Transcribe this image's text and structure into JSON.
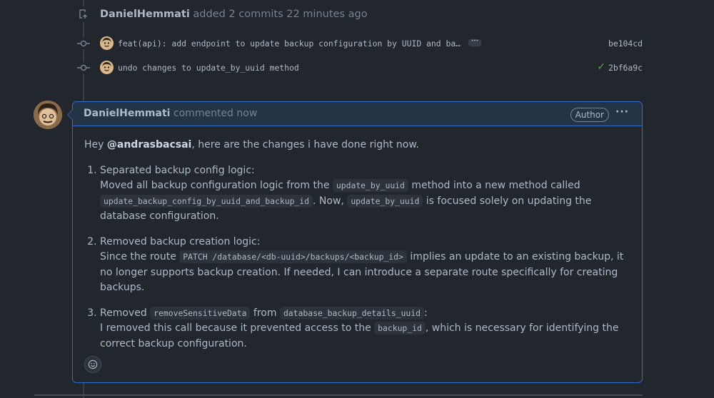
{
  "push_event": {
    "author": "DanielHemmati",
    "text": "added 2 commits 22 minutes ago"
  },
  "commits": [
    {
      "message": "feat(api): add endpoint to update backup configuration by UUID and ba…",
      "sha": "be104cd",
      "ellipsis": "···"
    },
    {
      "message": "undo changes to update_by_uuid method",
      "sha": "2bf6a9c",
      "check": "✓"
    }
  ],
  "comment": {
    "author": "DanielHemmati",
    "action": "commented now",
    "badge": "Author",
    "menu": "···",
    "greeting_pre": "Hey ",
    "mention": "@andrasbacsai",
    "greeting_post": ", here are the changes i have done right now.",
    "items": [
      {
        "title": "Separated backup config logic:",
        "t1": "Moved all backup configuration logic from the ",
        "c1": "update_by_uuid",
        "t2": " method into a new method called ",
        "c2": "update_backup_config_by_uuid_and_backup_id",
        "t3": ". Now, ",
        "c3": "update_by_uuid",
        "t4": " is focused solely on updating the database configuration."
      },
      {
        "title": "Removed backup creation logic:",
        "t1": "Since the route ",
        "c1": "PATCH /database/<db-uuid>/backups/<backup_id>",
        "t2": " implies an update to an existing backup, it no longer supports backup creation. If needed, I can introduce a separate route specifically for creating backups."
      },
      {
        "title_pre": "Removed ",
        "title_c1": "removeSensitiveData",
        "title_mid": " from ",
        "title_c2": "database_backup_details_uuid",
        "title_post": ":",
        "t1": "I removed this call because it prevented access to the ",
        "c1": "backup_id",
        "t2": ", which is necessary for identifying the correct backup configuration."
      }
    ]
  },
  "colors": {
    "background": "#22272e",
    "accent_border": "#316dca",
    "success": "#57ab5a"
  }
}
